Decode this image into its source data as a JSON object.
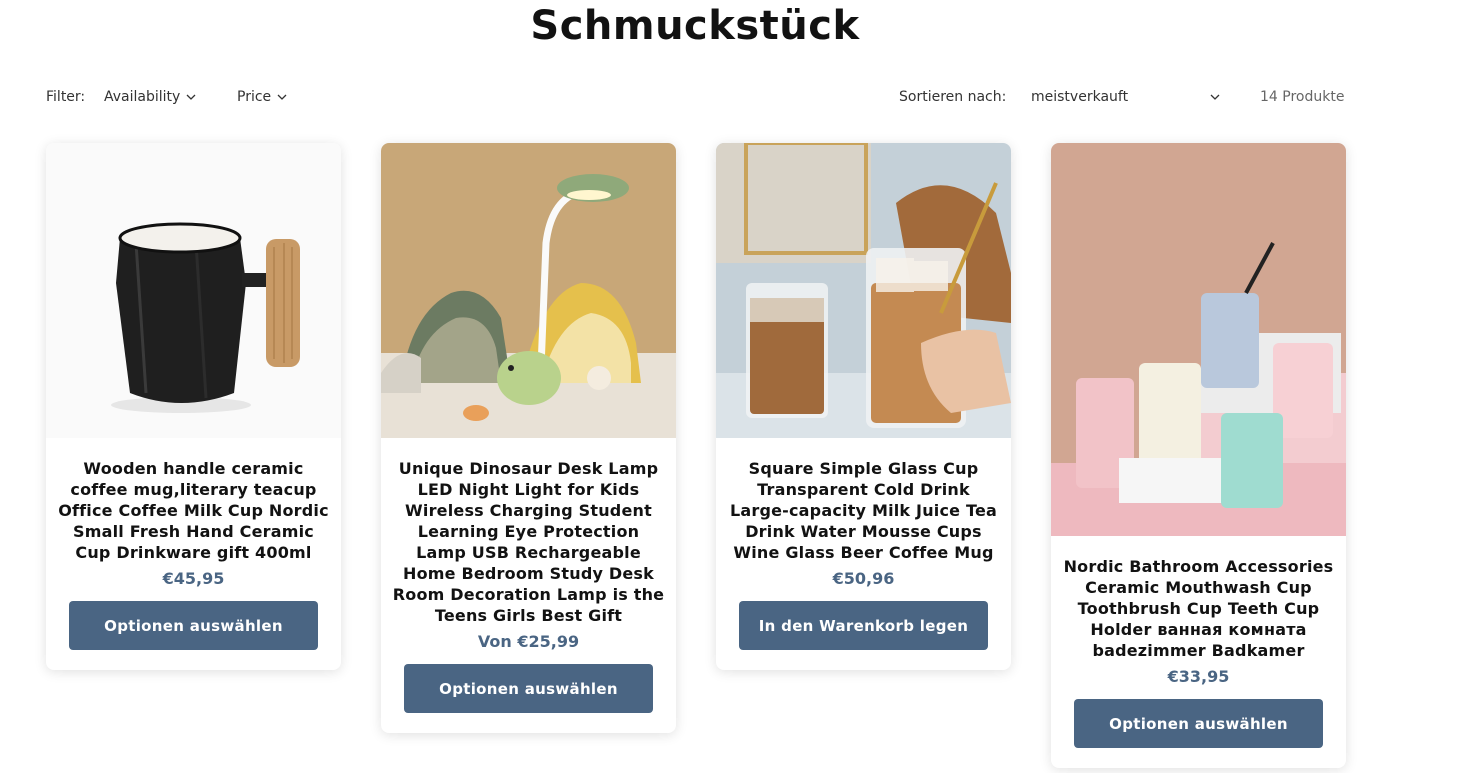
{
  "collection": {
    "title": "Schmuckstück"
  },
  "filters": {
    "label": "Filter:",
    "items": [
      "Availability",
      "Price"
    ]
  },
  "sort": {
    "label": "Sortieren nach:",
    "value": "meistverkauft"
  },
  "product_count": "14 Produkte",
  "products": [
    {
      "title": "Wooden handle ceramic coffee mug,literary teacup Office Coffee Milk Cup Nordic Small Fresh Hand Ceramic Cup Drinkware gift 400ml",
      "price": "€45,95",
      "button": "Optionen auswählen"
    },
    {
      "title": "Unique Dinosaur Desk Lamp LED Night Light for Kids Wireless Charging Student Learning Eye Protection Lamp USB Rechargeable Home Bedroom Study Desk Room Decoration Lamp is the Teens Girls Best Gift",
      "price": "Von €25,99",
      "button": "Optionen auswählen"
    },
    {
      "title": "Square Simple Glass Cup Transparent Cold Drink Large-capacity Milk Juice Tea Drink Water Mousse Cups Wine Glass Beer Coffee Mug",
      "price": "€50,96",
      "button": "In den Warenkorb legen"
    },
    {
      "title": "Nordic Bathroom Accessories Ceramic Mouthwash Cup Toothbrush Cup Teeth Cup Holder ванная комната badezimmer Badkamer",
      "price": "€33,95",
      "button": "Optionen auswählen"
    }
  ],
  "colors": {
    "accent": "#4a6583",
    "text": "#121212"
  }
}
